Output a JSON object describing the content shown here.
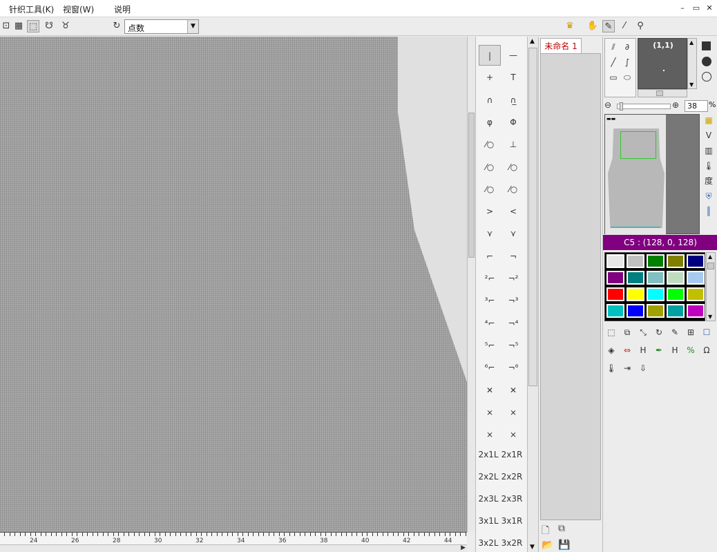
{
  "menu": {
    "items": [
      "针织工具(K)",
      "视窗(W)",
      "说明"
    ],
    "window_buttons": [
      "–",
      "▭",
      "✕"
    ]
  },
  "toolbar": {
    "mode_select": {
      "value": "点数"
    }
  },
  "ruler": {
    "labels": [
      "24",
      "26",
      "28",
      "30",
      "32",
      "34",
      "36",
      "38",
      "40",
      "42",
      "44"
    ]
  },
  "stitch_palette": {
    "glyphs": [
      "|",
      "—",
      "+",
      "T",
      "∩",
      "∩̲",
      "φ",
      "Φ",
      "⁄○",
      "⊥",
      "⁄○",
      "⁄○",
      "⁄○",
      "⁄○",
      ">",
      "<",
      "⋎",
      "⋎",
      "⌐",
      "¬",
      "²⌐",
      "¬²",
      "³⌐",
      "¬³",
      "⁴⌐",
      "¬⁴",
      "⁵⌐",
      "¬⁵",
      "⁶⌐",
      "¬⁶",
      "✕",
      "✕",
      "⨯",
      "⨯",
      "⨯",
      "⨯"
    ],
    "text_items": [
      "2x1L",
      "2x1R",
      "2x2L",
      "2x2R",
      "2x3L",
      "2x3R",
      "3x1L",
      "3x1R",
      "3x2L",
      "3x2R"
    ]
  },
  "file": {
    "tab_label": "未命名 1"
  },
  "preview": {
    "coord_label": "(1,1)"
  },
  "zoom": {
    "value": "38",
    "unit": "%"
  },
  "color": {
    "current_label": "C5 : (128, 0, 128)",
    "palette": [
      "#e6e6e6",
      "#c0c0c0",
      "#008000",
      "#808000",
      "#000080",
      "#800080",
      "#008080",
      "#80c0c0",
      "#c0dcc0",
      "#a6caf0",
      "#ff0000",
      "#ffff00",
      "#00ffff",
      "#00ff00",
      "#c0c000",
      "#00c0c0",
      "#0000ff",
      "#a0a000",
      "#00a0a0",
      "#c000c0"
    ]
  },
  "nav_side": {
    "degree_char": "度"
  }
}
